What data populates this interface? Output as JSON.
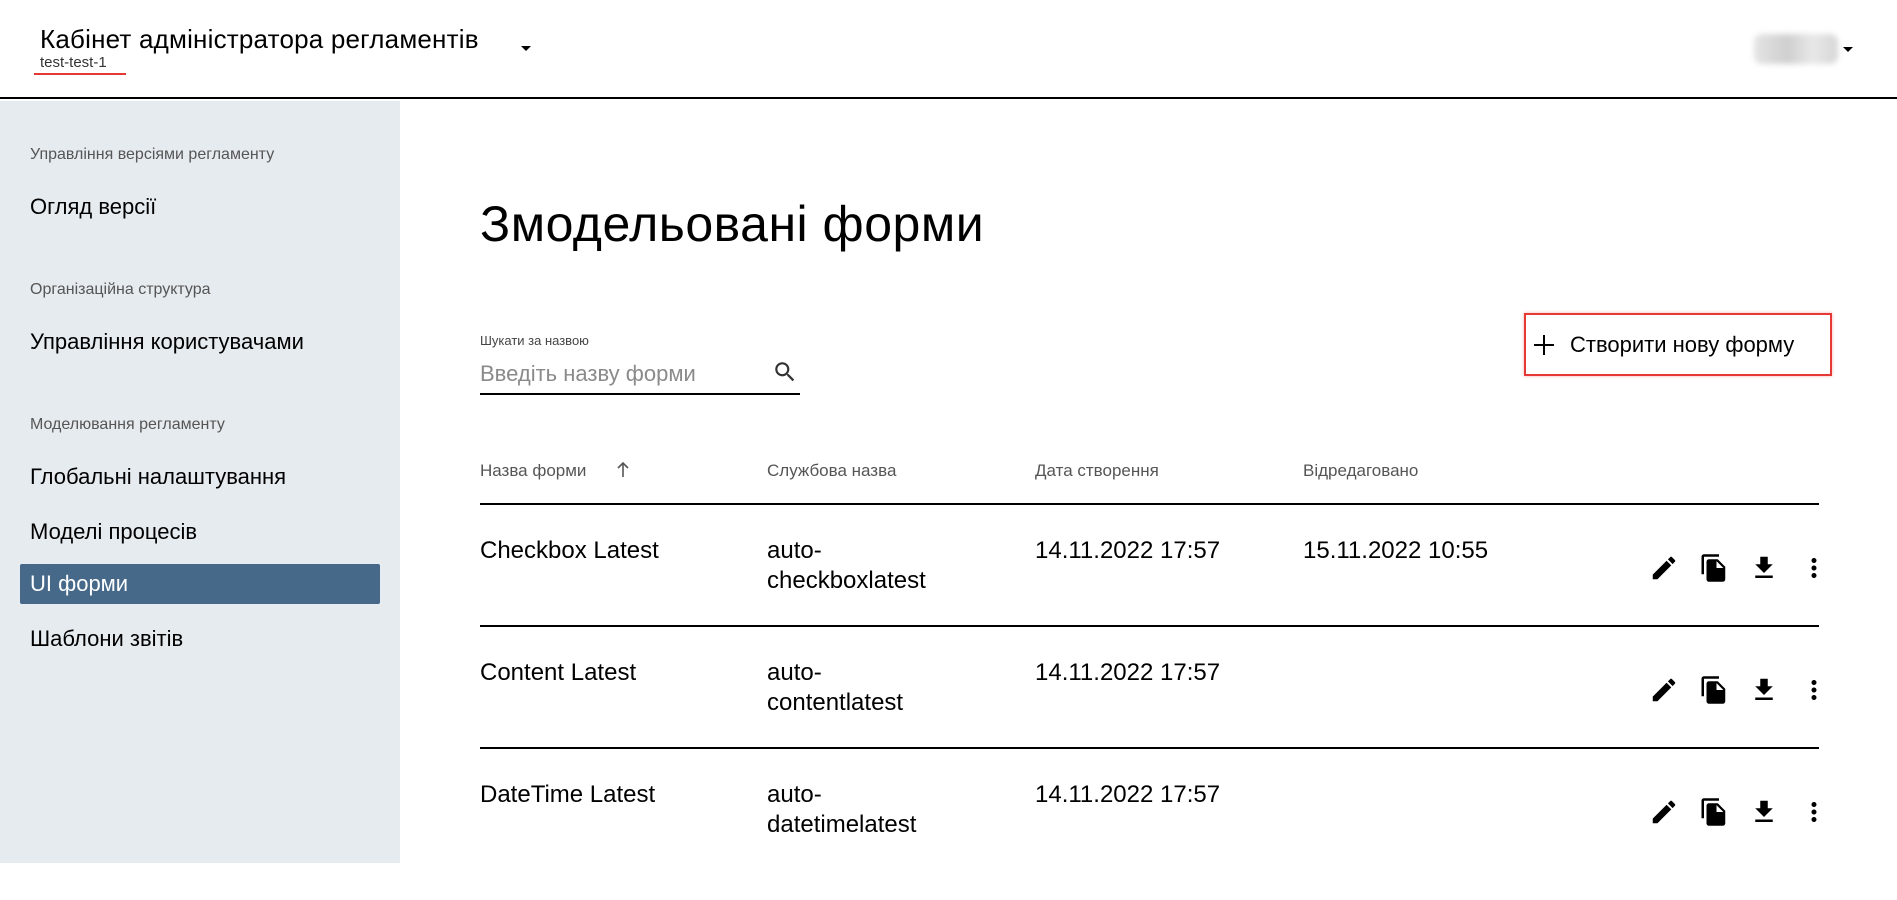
{
  "header": {
    "app_title": "Кабінет адміністратора регламентів",
    "env_name": "test-test-1"
  },
  "sidebar": {
    "sections": [
      {
        "title": "Управління версіями регламенту",
        "items": [
          {
            "label": "Огляд версії"
          }
        ]
      },
      {
        "title": "Організаційна структура",
        "items": [
          {
            "label": "Управління користувачами"
          }
        ]
      },
      {
        "title": "Моделювання регламенту",
        "items": [
          {
            "label": "Глобальні налаштування"
          },
          {
            "label": "Моделі процесів"
          },
          {
            "label": "UI форми",
            "active": true
          },
          {
            "label": "Шаблони звітів"
          }
        ]
      }
    ]
  },
  "main": {
    "title": "Змодельовані форми",
    "search": {
      "label": "Шукати за назвою",
      "placeholder": "Введіть назву форми",
      "value": ""
    },
    "create_button": "Створити нову форму",
    "table": {
      "columns": [
        "Назва форми",
        "Службова назва",
        "Дата створення",
        "Відредаговано"
      ],
      "sorted_column": "Назва форми",
      "sort_direction": "ascending",
      "rows": [
        {
          "name": "Checkbox Latest",
          "service_name_1": "auto-",
          "service_name_2": "checkboxlatest",
          "created": "14.11.2022 17:57",
          "edited": "15.11.2022 10:55"
        },
        {
          "name": "Content Latest",
          "service_name_1": "auto-",
          "service_name_2": "contentlatest",
          "created": "14.11.2022 17:57",
          "edited": ""
        },
        {
          "name": "DateTime Latest",
          "service_name_1": "auto-",
          "service_name_2": "datetimelatest",
          "created": "14.11.2022 17:57",
          "edited": ""
        }
      ],
      "row_actions": [
        "edit-icon",
        "copy-icon",
        "download-icon",
        "more-vert-icon"
      ]
    }
  },
  "colors": {
    "sidebar_bg": "#e6ebf0",
    "active_item_bg": "#46698a",
    "highlight_border": "#e53935"
  }
}
